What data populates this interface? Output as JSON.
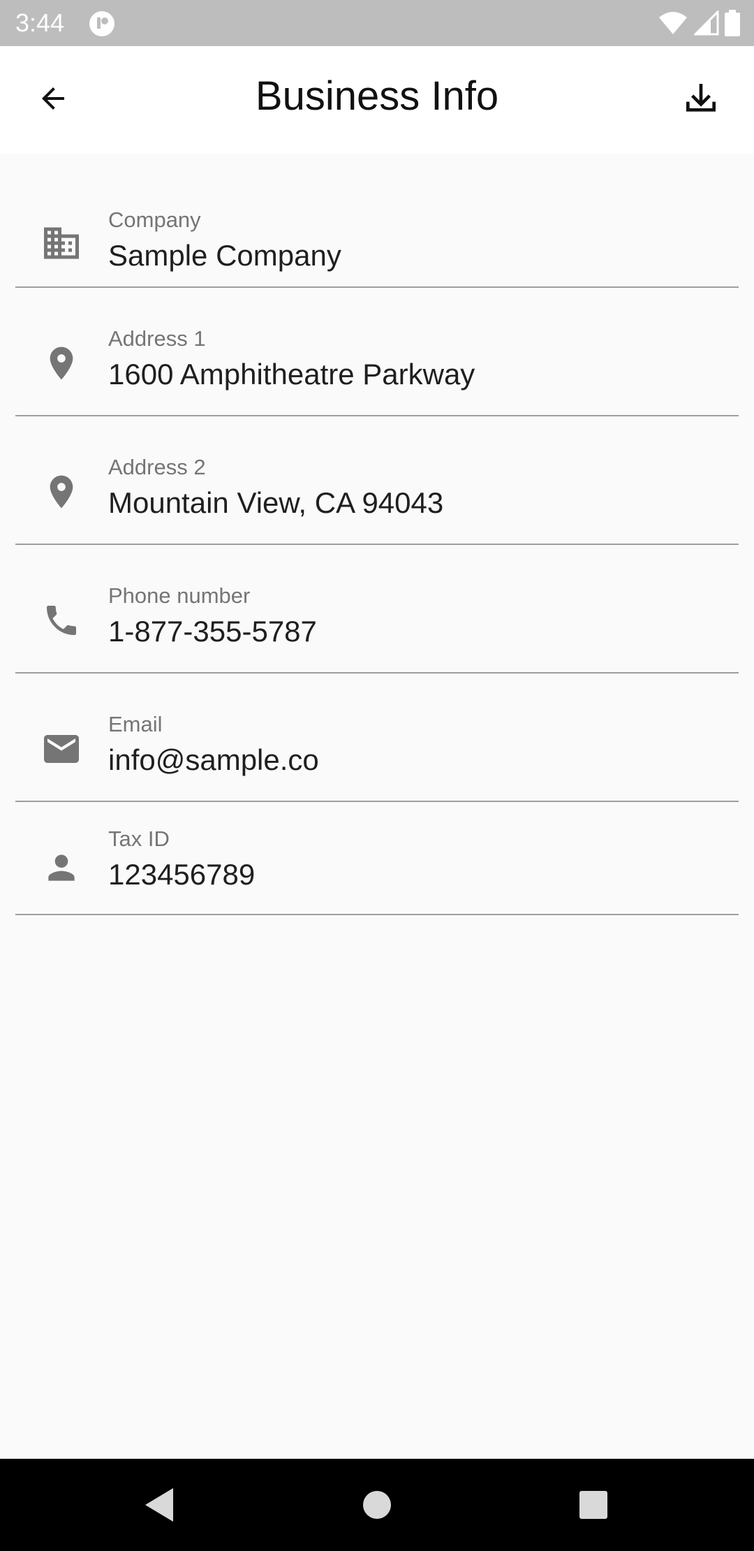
{
  "status_bar": {
    "time": "3:44",
    "icons": [
      "app-notification-icon",
      "wifi-icon",
      "signal-icon",
      "battery-icon"
    ]
  },
  "app_bar": {
    "title": "Business Info",
    "back_icon": "arrow-back-icon",
    "action_icon": "download-icon"
  },
  "fields": [
    {
      "label": "Company",
      "value": "Sample Company",
      "icon": "business-icon"
    },
    {
      "label": "Address 1",
      "value": "1600 Amphitheatre Parkway",
      "icon": "location-pin-icon"
    },
    {
      "label": "Address 2",
      "value": "Mountain View, CA 94043",
      "icon": "location-pin-icon"
    },
    {
      "label": "Phone number",
      "value": "1-877-355-5787",
      "icon": "phone-icon"
    },
    {
      "label": "Email",
      "value": "info@sample.co",
      "icon": "email-icon"
    },
    {
      "label": "Tax ID",
      "value": "123456789",
      "icon": "person-icon"
    }
  ],
  "nav_bar": {
    "icons": [
      "back-triangle-icon",
      "home-circle-icon",
      "recents-square-icon"
    ]
  },
  "colors": {
    "status_bar": "#bdbdbd",
    "background": "#fafafa",
    "app_bar": "#ffffff",
    "icon_gray": "#757575",
    "divider": "#9e9e9e",
    "nav_bar": "#000000"
  }
}
